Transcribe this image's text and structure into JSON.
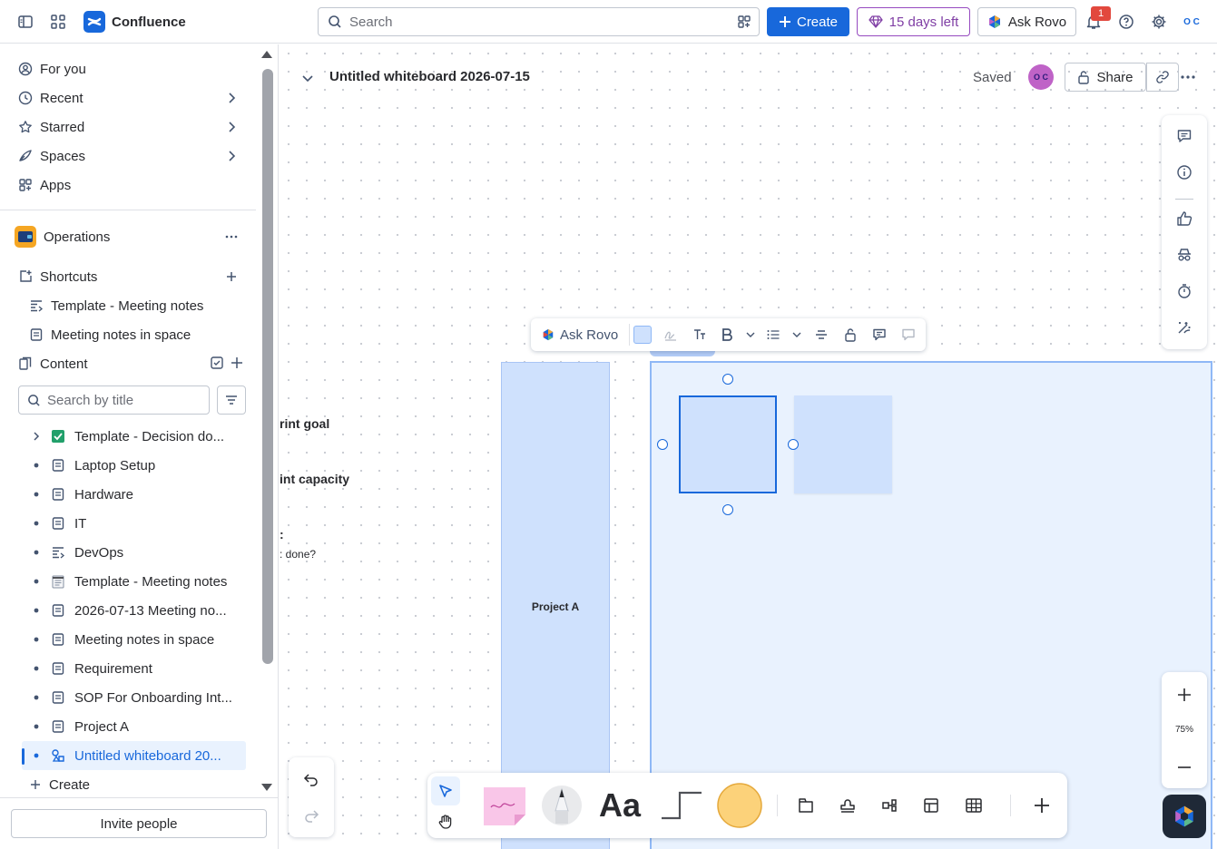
{
  "app": {
    "name": "Confluence"
  },
  "topbar": {
    "search_placeholder": "Search",
    "create_label": "Create",
    "trial_label": "15 days left",
    "ask_rovo_label": "Ask Rovo",
    "notification_count": "1",
    "avatar_initials": "O C"
  },
  "sidebar": {
    "nav": [
      {
        "label": "For you"
      },
      {
        "label": "Recent"
      },
      {
        "label": "Starred"
      },
      {
        "label": "Spaces"
      },
      {
        "label": "Apps"
      }
    ],
    "space_name": "Operations",
    "shortcuts_label": "Shortcuts",
    "shortcuts": [
      {
        "label": "Template - Meeting notes"
      },
      {
        "label": "Meeting notes in space"
      }
    ],
    "content_label": "Content",
    "search_placeholder": "Search by title",
    "tree": [
      {
        "label": "Template - Decision do...",
        "icon": "check-box-icon"
      },
      {
        "label": "Laptop Setup",
        "icon": "page-icon"
      },
      {
        "label": "Hardware",
        "icon": "page-icon"
      },
      {
        "label": "IT",
        "icon": "page-icon"
      },
      {
        "label": "DevOps",
        "icon": "page-lines-icon"
      },
      {
        "label": "Template - Meeting notes",
        "icon": "notepad-icon"
      },
      {
        "label": "2026-07-13 Meeting no...",
        "icon": "page-icon"
      },
      {
        "label": "Meeting notes in space",
        "icon": "page-icon"
      },
      {
        "label": "Requirement",
        "icon": "page-icon"
      },
      {
        "label": "SOP For Onboarding Int...",
        "icon": "page-icon"
      },
      {
        "label": "Project A",
        "icon": "page-icon"
      },
      {
        "label": "Untitled whiteboard 20...",
        "icon": "whiteboard-icon",
        "selected": true
      }
    ],
    "create_label": "Create",
    "invite_label": "Invite people"
  },
  "whiteboard": {
    "title": "Untitled whiteboard 2026-07-15",
    "saved_label": "Saved",
    "share_label": "Share",
    "context_toolbar": {
      "ask_rovo_label": "Ask Rovo",
      "fill_color": "#cfe1fd"
    },
    "canvas_text": {
      "sprint_goal": "rint goal",
      "sprint_capacity": "int capacity",
      "colon": ":",
      "done_question": ": done?",
      "project_a": "Project A"
    },
    "zoom_level": "75%"
  },
  "colors": {
    "accent": "#1868db",
    "trial": "#803fa5",
    "frame": "#e9f2fe",
    "sticky": "#cfe1fd"
  }
}
